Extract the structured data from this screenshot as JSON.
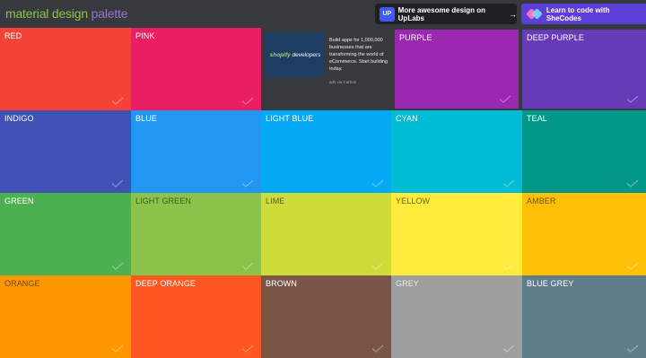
{
  "header": {
    "logo_part1": "material design",
    "logo_part2": "palette"
  },
  "promos": {
    "uplabs_badge": "UP",
    "uplabs_label": "More awesome design on UpLabs",
    "shecodes_label": "Learn to code with SheCodes",
    "arrow": "→"
  },
  "ad": {
    "brand_prefix": "shopify",
    "brand_suffix": " developers",
    "text": "Build apps for 1,000,000 businesses that are transforming the world of eCommerce. Start building today.",
    "via": "ads via Carbon"
  },
  "colors": [
    {
      "name": "RED",
      "hex": "#f44336",
      "text_color": "#ffffff"
    },
    {
      "name": "PINK",
      "hex": "#e91e63",
      "text_color": "#ffffff"
    },
    {
      "name": "PURPLE",
      "hex": "#9c27b0",
      "text_color": "#ffffff"
    },
    {
      "name": "DEEP PURPLE",
      "hex": "#673ab7",
      "text_color": "#ffffff"
    },
    {
      "name": "INDIGO",
      "hex": "#3f51b5",
      "text_color": "#ffffff"
    },
    {
      "name": "BLUE",
      "hex": "#2196f3",
      "text_color": "#ffffff"
    },
    {
      "name": "LIGHT BLUE",
      "hex": "#03a9f4",
      "text_color": "#ffffff"
    },
    {
      "name": "CYAN",
      "hex": "#00bcd4",
      "text_color": "#ffffff"
    },
    {
      "name": "TEAL",
      "hex": "#009688",
      "text_color": "#ffffff"
    },
    {
      "name": "GREEN",
      "hex": "#4caf50",
      "text_color": "#ffffff"
    },
    {
      "name": "LIGHT GREEN",
      "hex": "#8bc34a",
      "text_color": "#3d5a22"
    },
    {
      "name": "LIME",
      "hex": "#cddc39",
      "text_color": "#5a6118"
    },
    {
      "name": "YELLOW",
      "hex": "#ffeb3b",
      "text_color": "#6d6318"
    },
    {
      "name": "AMBER",
      "hex": "#ffc107",
      "text_color": "#6e5410"
    },
    {
      "name": "ORANGE",
      "hex": "#ff9800",
      "text_color": "#6e4a10"
    },
    {
      "name": "DEEP ORANGE",
      "hex": "#ff5722",
      "text_color": "#ffffff"
    },
    {
      "name": "BROWN",
      "hex": "#795548",
      "text_color": "#ffffff"
    },
    {
      "name": "GREY",
      "hex": "#9e9e9e",
      "text_color": "#e8e8e8"
    },
    {
      "name": "BLUE GREY",
      "hex": "#607d8b",
      "text_color": "#ffffff"
    }
  ]
}
